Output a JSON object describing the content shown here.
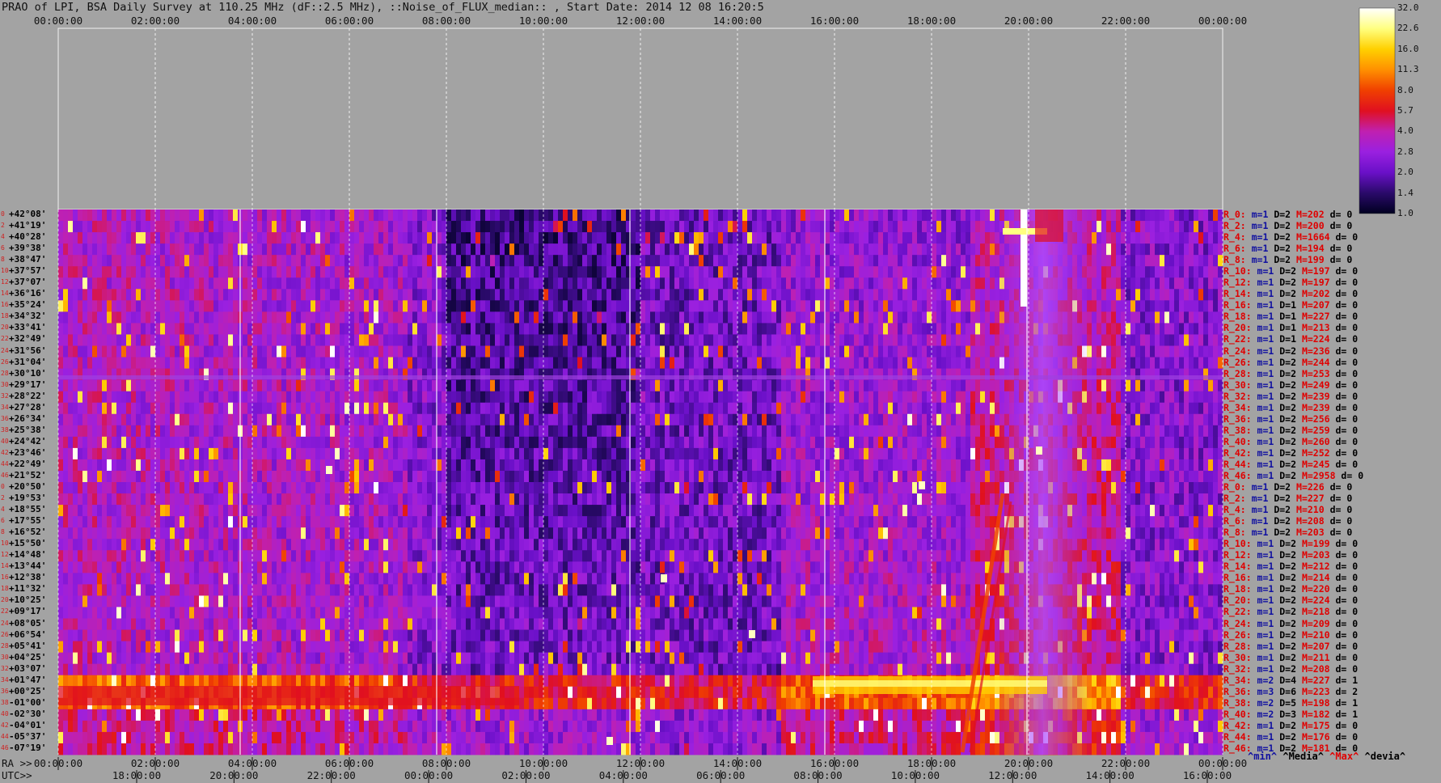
{
  "title": "PRAO of LPI, BSA Daily Survey at 110.25 MHz (dF::2.5 MHz), ::Noise_of_FLUX_median:: , Start Date: 2014 12 08 16:20:5",
  "chart_data": {
    "type": "heatmap",
    "top_axis_ticks": [
      "00:00:00",
      "02:00:00",
      "04:00:00",
      "06:00:00",
      "08:00:00",
      "10:00:00",
      "12:00:00",
      "14:00:00",
      "16:00:00",
      "18:00:00",
      "20:00:00",
      "22:00:00",
      "00:00:00"
    ],
    "ra_label": "RA >>",
    "ra_ticks": [
      "00:00:00",
      "02:00:00",
      "04:00:00",
      "06:00:00",
      "08:00:00",
      "10:00:00",
      "12:00:00",
      "14:00:00",
      "16:00:00",
      "18:00:00",
      "20:00:00",
      "22:00:00",
      "00:00:00"
    ],
    "utc_label": "UTC>>",
    "utc_ticks": [
      "18:00:00",
      "20:00:00",
      "22:00:00",
      "00:00:00",
      "02:00:00",
      "04:00:00",
      "06:00:00",
      "08:00:00",
      "10:00:00",
      "12:00:00",
      "14:00:00",
      "16:00:00"
    ],
    "declinations": [
      "+42°08'",
      "+41°19'",
      "+40°28'",
      "+39°38'",
      "+38°47'",
      "+37°57'",
      "+37°07'",
      "+36°16'",
      "+35°24'",
      "+34°32'",
      "+33°41'",
      "+32°49'",
      "+31°56'",
      "+31°04'",
      "+30°10'",
      "+29°17'",
      "+28°22'",
      "+27°28'",
      "+26°34'",
      "+25°38'",
      "+24°42'",
      "+23°46'",
      "+22°49'",
      "+21°52'",
      "+20°50'",
      "+19°53'",
      "+18°55'",
      "+17°55'",
      "+16°52'",
      "+15°50'",
      "+14°48'",
      "+13°44'",
      "+12°38'",
      "+11°32'",
      "+10°25'",
      "+09°17'",
      "+08°05'",
      "+06°54'",
      "+05°41'",
      "+04°25'",
      "+03°07'",
      "+01°47'",
      "+00°25'",
      "-01°00'",
      "-02°30'",
      "-04°01'",
      "-05°37'",
      "-07°19'"
    ],
    "row_indices": [
      "0",
      "2",
      "4",
      "6",
      "8",
      "10",
      "12",
      "14",
      "16",
      "18",
      "20",
      "22",
      "24",
      "26",
      "28",
      "30",
      "32",
      "34",
      "36",
      "38",
      "40",
      "42",
      "44",
      "46",
      "0",
      "2",
      "4",
      "6",
      "8",
      "10",
      "12",
      "14",
      "16",
      "18",
      "20",
      "22",
      "24",
      "26",
      "28",
      "30",
      "32",
      "34",
      "36",
      "38",
      "40",
      "42",
      "44",
      "46"
    ],
    "row_stats": [
      {
        "r": "R_0:",
        "m": "m=1",
        "D": "D=2",
        "M": "M=202",
        "d": "d= 0"
      },
      {
        "r": "R_2:",
        "m": "m=1",
        "D": "D=2",
        "M": "M=200",
        "d": "d= 0"
      },
      {
        "r": "R_4:",
        "m": "m=1",
        "D": "D=2",
        "M": "M=1664",
        "d": "d= 0"
      },
      {
        "r": "R_6:",
        "m": "m=1",
        "D": "D=2",
        "M": "M=194",
        "d": "d= 0"
      },
      {
        "r": "R_8:",
        "m": "m=1",
        "D": "D=2",
        "M": "M=199",
        "d": "d= 0"
      },
      {
        "r": "R_10:",
        "m": "m=1",
        "D": "D=2",
        "M": "M=197",
        "d": "d= 0"
      },
      {
        "r": "R_12:",
        "m": "m=1",
        "D": "D=2",
        "M": "M=197",
        "d": "d= 0"
      },
      {
        "r": "R_14:",
        "m": "m=1",
        "D": "D=2",
        "M": "M=202",
        "d": "d= 0"
      },
      {
        "r": "R_16:",
        "m": "m=1",
        "D": "D=1",
        "M": "M=207",
        "d": "d= 0"
      },
      {
        "r": "R_18:",
        "m": "m=1",
        "D": "D=1",
        "M": "M=227",
        "d": "d= 0"
      },
      {
        "r": "R_20:",
        "m": "m=1",
        "D": "D=1",
        "M": "M=213",
        "d": "d= 0"
      },
      {
        "r": "R_22:",
        "m": "m=1",
        "D": "D=1",
        "M": "M=224",
        "d": "d= 0"
      },
      {
        "r": "R_24:",
        "m": "m=1",
        "D": "D=2",
        "M": "M=236",
        "d": "d= 0"
      },
      {
        "r": "R_26:",
        "m": "m=1",
        "D": "D=2",
        "M": "M=244",
        "d": "d= 0"
      },
      {
        "r": "R_28:",
        "m": "m=1",
        "D": "D=2",
        "M": "M=253",
        "d": "d= 0"
      },
      {
        "r": "R_30:",
        "m": "m=1",
        "D": "D=2",
        "M": "M=249",
        "d": "d= 0"
      },
      {
        "r": "R_32:",
        "m": "m=1",
        "D": "D=2",
        "M": "M=239",
        "d": "d= 0"
      },
      {
        "r": "R_34:",
        "m": "m=1",
        "D": "D=2",
        "M": "M=239",
        "d": "d= 0"
      },
      {
        "r": "R_36:",
        "m": "m=1",
        "D": "D=2",
        "M": "M=256",
        "d": "d= 0"
      },
      {
        "r": "R_38:",
        "m": "m=1",
        "D": "D=2",
        "M": "M=259",
        "d": "d= 0"
      },
      {
        "r": "R_40:",
        "m": "m=1",
        "D": "D=2",
        "M": "M=260",
        "d": "d= 0"
      },
      {
        "r": "R_42:",
        "m": "m=1",
        "D": "D=2",
        "M": "M=252",
        "d": "d= 0"
      },
      {
        "r": "R_44:",
        "m": "m=1",
        "D": "D=2",
        "M": "M=245",
        "d": "d= 0"
      },
      {
        "r": "R_46:",
        "m": "m=1",
        "D": "D=2",
        "M": "M=2958",
        "d": "d= 0"
      },
      {
        "r": "R_0:",
        "m": "m=1",
        "D": "D=2",
        "M": "M=226",
        "d": "d= 0"
      },
      {
        "r": "R_2:",
        "m": "m=1",
        "D": "D=2",
        "M": "M=227",
        "d": "d= 0"
      },
      {
        "r": "R_4:",
        "m": "m=1",
        "D": "D=2",
        "M": "M=210",
        "d": "d= 0"
      },
      {
        "r": "R_6:",
        "m": "m=1",
        "D": "D=2",
        "M": "M=208",
        "d": "d= 0"
      },
      {
        "r": "R_8:",
        "m": "m=1",
        "D": "D=2",
        "M": "M=203",
        "d": "d= 0"
      },
      {
        "r": "R_10:",
        "m": "m=1",
        "D": "D=2",
        "M": "M=199",
        "d": "d= 0"
      },
      {
        "r": "R_12:",
        "m": "m=1",
        "D": "D=2",
        "M": "M=203",
        "d": "d= 0"
      },
      {
        "r": "R_14:",
        "m": "m=1",
        "D": "D=2",
        "M": "M=212",
        "d": "d= 0"
      },
      {
        "r": "R_16:",
        "m": "m=1",
        "D": "D=2",
        "M": "M=214",
        "d": "d= 0"
      },
      {
        "r": "R_18:",
        "m": "m=1",
        "D": "D=2",
        "M": "M=220",
        "d": "d= 0"
      },
      {
        "r": "R_20:",
        "m": "m=1",
        "D": "D=2",
        "M": "M=224",
        "d": "d= 0"
      },
      {
        "r": "R_22:",
        "m": "m=1",
        "D": "D=2",
        "M": "M=218",
        "d": "d= 0"
      },
      {
        "r": "R_24:",
        "m": "m=1",
        "D": "D=2",
        "M": "M=209",
        "d": "d= 0"
      },
      {
        "r": "R_26:",
        "m": "m=1",
        "D": "D=2",
        "M": "M=210",
        "d": "d= 0"
      },
      {
        "r": "R_28:",
        "m": "m=1",
        "D": "D=2",
        "M": "M=207",
        "d": "d= 0"
      },
      {
        "r": "R_30:",
        "m": "m=1",
        "D": "D=2",
        "M": "M=211",
        "d": "d= 0"
      },
      {
        "r": "R_32:",
        "m": "m=1",
        "D": "D=2",
        "M": "M=208",
        "d": "d= 0"
      },
      {
        "r": "R_34:",
        "m": "m=2",
        "D": "D=4",
        "M": "M=227",
        "d": "d= 1"
      },
      {
        "r": "R_36:",
        "m": "m=3",
        "D": "D=6",
        "M": "M=223",
        "d": "d= 2"
      },
      {
        "r": "R_38:",
        "m": "m=2",
        "D": "D=5",
        "M": "M=198",
        "d": "d= 1"
      },
      {
        "r": "R_40:",
        "m": "m=2",
        "D": "D=3",
        "M": "M=182",
        "d": "d= 1"
      },
      {
        "r": "R_42:",
        "m": "m=1",
        "D": "D=2",
        "M": "M=175",
        "d": "d= 0"
      },
      {
        "r": "R_44:",
        "m": "m=1",
        "D": "D=2",
        "M": "M=176",
        "d": "d= 0"
      },
      {
        "r": "R_46:",
        "m": "m=1",
        "D": "D=2",
        "M": "M=181",
        "d": "d= 0"
      }
    ],
    "stats_legend": {
      "min": "^min^",
      "media": "^Media^",
      "max": "^Max^",
      "devia": "^devia^"
    },
    "colorbar": {
      "ticks": [
        "32.0",
        "22.6",
        "16.0",
        "11.3",
        "8.0",
        "5.7",
        "4.0",
        "2.8",
        "2.0",
        "1.4",
        "1.0"
      ],
      "stops": [
        "#000020",
        "#2a0a6a",
        "#6a10c8",
        "#9a20e0",
        "#c020b0",
        "#e01020",
        "#f04000",
        "#ff9000",
        "#ffd000",
        "#ffff80",
        "#ffffff"
      ]
    }
  }
}
